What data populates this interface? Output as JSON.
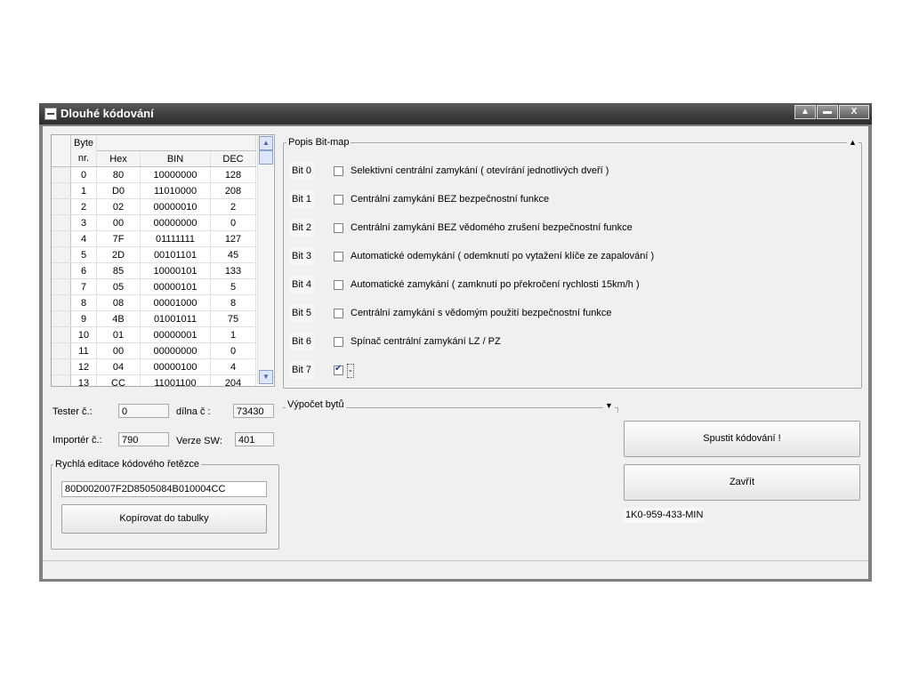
{
  "window": {
    "title": "Dlouhé kódování",
    "min_label": "▲",
    "restore_label": "▬",
    "close_label": "X"
  },
  "grid": {
    "headers": {
      "byte_line1": "Byte",
      "byte_line2": "nr.",
      "hex": "Hex",
      "bin": "BIN",
      "dec": "DEC"
    },
    "rows": [
      {
        "nr": "0",
        "hex": "80",
        "bin": "10000000",
        "dec": "128"
      },
      {
        "nr": "1",
        "hex": "D0",
        "bin": "11010000",
        "dec": "208"
      },
      {
        "nr": "2",
        "hex": "02",
        "bin": "00000010",
        "dec": "2"
      },
      {
        "nr": "3",
        "hex": "00",
        "bin": "00000000",
        "dec": "0"
      },
      {
        "nr": "4",
        "hex": "7F",
        "bin": "01111111",
        "dec": "127"
      },
      {
        "nr": "5",
        "hex": "2D",
        "bin": "00101101",
        "dec": "45"
      },
      {
        "nr": "6",
        "hex": "85",
        "bin": "10000101",
        "dec": "133"
      },
      {
        "nr": "7",
        "hex": "05",
        "bin": "00000101",
        "dec": "5"
      },
      {
        "nr": "8",
        "hex": "08",
        "bin": "00001000",
        "dec": "8"
      },
      {
        "nr": "9",
        "hex": "4B",
        "bin": "01001011",
        "dec": "75"
      },
      {
        "nr": "10",
        "hex": "01",
        "bin": "00000001",
        "dec": "1"
      },
      {
        "nr": "11",
        "hex": "00",
        "bin": "00000000",
        "dec": "0"
      },
      {
        "nr": "12",
        "hex": "04",
        "bin": "00000100",
        "dec": "4"
      },
      {
        "nr": "13",
        "hex": "CC",
        "bin": "11001100",
        "dec": "204"
      }
    ]
  },
  "fields": {
    "tester_label": "Tester č.:",
    "tester_value": "0",
    "dilna_label": "dílna č :",
    "dilna_value": "73430",
    "importer_label": "Importér č.:",
    "importer_value": "790",
    "verze_label": "Verze SW:",
    "verze_value": "401"
  },
  "quick_edit": {
    "title": "Rychlá editace kódového řetězce",
    "code": "80D002007F2D8505084B010004CC",
    "copy_button": "Kopírovat do tabulky"
  },
  "bitmap": {
    "title": "Popis Bit-map",
    "collapse_glyph": "▲",
    "bits": [
      {
        "label": "Bit 0",
        "text": "Selektivní centrální zamykání ( otevírání jednotlivých dveří )",
        "checked": false
      },
      {
        "label": "Bit 1",
        "text": "Centrální zamykání BEZ bezpečnostní funkce",
        "checked": false
      },
      {
        "label": "Bit 2",
        "text": "Centrální zamykání BEZ vědomého zrušení bezpečnostní funkce",
        "checked": false
      },
      {
        "label": "Bit 3",
        "text": "Automatické odemykání ( odemknutí po vytažení klíče ze zapalování )",
        "checked": false
      },
      {
        "label": "Bit 4",
        "text": "Automatické zamykání ( zamknutí po překročení rychlosti 15km/h )",
        "checked": false
      },
      {
        "label": "Bit 5",
        "text": "Centrální zamykání s vědomým použití  bezpečnostní funkce",
        "checked": false
      },
      {
        "label": "Bit 6",
        "text": "Spínač centrální zamykání LZ / PZ",
        "checked": false
      },
      {
        "label": "Bit 7",
        "text": "-",
        "checked": true
      }
    ]
  },
  "vypocet": {
    "title": "Výpočet bytů",
    "glyph": "▼"
  },
  "buttons": {
    "run": "Spustit kódování !",
    "close": "Zavřít"
  },
  "part_number": "1K0-959-433-MIN"
}
